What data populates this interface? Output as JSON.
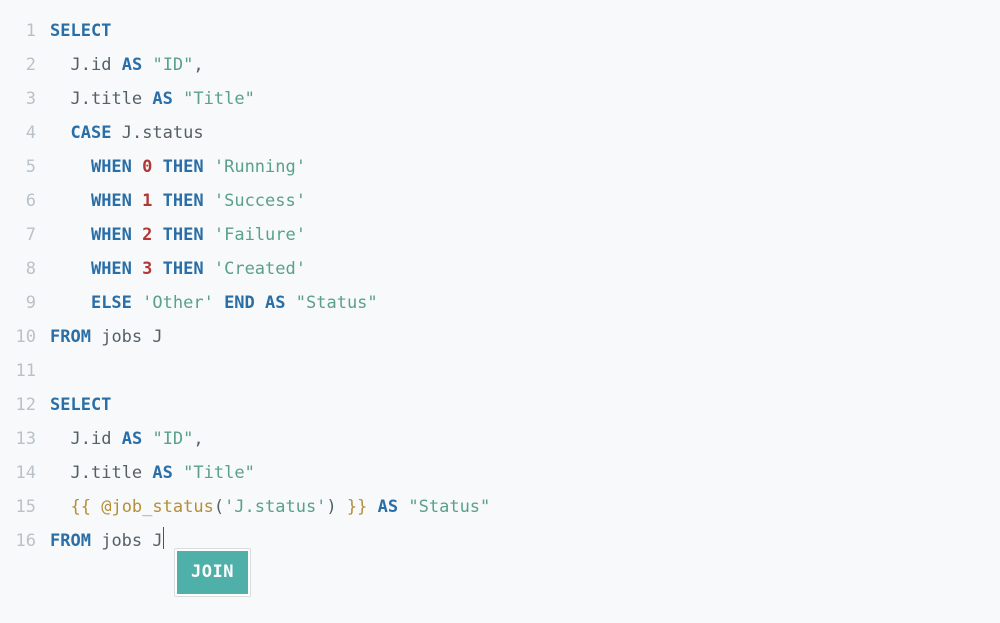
{
  "lines": [
    {
      "n": "1",
      "tokens": [
        {
          "cls": "tok-kw",
          "t": "SELECT"
        }
      ]
    },
    {
      "n": "2",
      "tokens": [
        {
          "cls": "",
          "t": "  "
        },
        {
          "cls": "tok-ident",
          "t": "J"
        },
        {
          "cls": "tok-punct",
          "t": "."
        },
        {
          "cls": "tok-ident",
          "t": "id"
        },
        {
          "cls": "",
          "t": " "
        },
        {
          "cls": "tok-kw",
          "t": "AS"
        },
        {
          "cls": "",
          "t": " "
        },
        {
          "cls": "tok-str",
          "t": "\"ID\""
        },
        {
          "cls": "tok-punct",
          "t": ","
        }
      ]
    },
    {
      "n": "3",
      "tokens": [
        {
          "cls": "",
          "t": "  "
        },
        {
          "cls": "tok-ident",
          "t": "J"
        },
        {
          "cls": "tok-punct",
          "t": "."
        },
        {
          "cls": "tok-ident",
          "t": "title"
        },
        {
          "cls": "",
          "t": " "
        },
        {
          "cls": "tok-kw",
          "t": "AS"
        },
        {
          "cls": "",
          "t": " "
        },
        {
          "cls": "tok-str",
          "t": "\"Title\""
        }
      ]
    },
    {
      "n": "4",
      "tokens": [
        {
          "cls": "",
          "t": "  "
        },
        {
          "cls": "tok-kw",
          "t": "CASE"
        },
        {
          "cls": "",
          "t": " "
        },
        {
          "cls": "tok-ident",
          "t": "J"
        },
        {
          "cls": "tok-punct",
          "t": "."
        },
        {
          "cls": "tok-ident",
          "t": "status"
        }
      ]
    },
    {
      "n": "5",
      "tokens": [
        {
          "cls": "",
          "t": "    "
        },
        {
          "cls": "tok-kw",
          "t": "WHEN"
        },
        {
          "cls": "",
          "t": " "
        },
        {
          "cls": "tok-num",
          "t": "0"
        },
        {
          "cls": "",
          "t": " "
        },
        {
          "cls": "tok-kw",
          "t": "THEN"
        },
        {
          "cls": "",
          "t": " "
        },
        {
          "cls": "tok-str",
          "t": "'Running'"
        }
      ]
    },
    {
      "n": "6",
      "tokens": [
        {
          "cls": "",
          "t": "    "
        },
        {
          "cls": "tok-kw",
          "t": "WHEN"
        },
        {
          "cls": "",
          "t": " "
        },
        {
          "cls": "tok-num",
          "t": "1"
        },
        {
          "cls": "",
          "t": " "
        },
        {
          "cls": "tok-kw",
          "t": "THEN"
        },
        {
          "cls": "",
          "t": " "
        },
        {
          "cls": "tok-str",
          "t": "'Success'"
        }
      ]
    },
    {
      "n": "7",
      "tokens": [
        {
          "cls": "",
          "t": "    "
        },
        {
          "cls": "tok-kw",
          "t": "WHEN"
        },
        {
          "cls": "",
          "t": " "
        },
        {
          "cls": "tok-num",
          "t": "2"
        },
        {
          "cls": "",
          "t": " "
        },
        {
          "cls": "tok-kw",
          "t": "THEN"
        },
        {
          "cls": "",
          "t": " "
        },
        {
          "cls": "tok-str",
          "t": "'Failure'"
        }
      ]
    },
    {
      "n": "8",
      "tokens": [
        {
          "cls": "",
          "t": "    "
        },
        {
          "cls": "tok-kw",
          "t": "WHEN"
        },
        {
          "cls": "",
          "t": " "
        },
        {
          "cls": "tok-num",
          "t": "3"
        },
        {
          "cls": "",
          "t": " "
        },
        {
          "cls": "tok-kw",
          "t": "THEN"
        },
        {
          "cls": "",
          "t": " "
        },
        {
          "cls": "tok-str",
          "t": "'Created'"
        }
      ]
    },
    {
      "n": "9",
      "tokens": [
        {
          "cls": "",
          "t": "    "
        },
        {
          "cls": "tok-kw",
          "t": "ELSE"
        },
        {
          "cls": "",
          "t": " "
        },
        {
          "cls": "tok-str",
          "t": "'Other'"
        },
        {
          "cls": "",
          "t": " "
        },
        {
          "cls": "tok-kw",
          "t": "END"
        },
        {
          "cls": "",
          "t": " "
        },
        {
          "cls": "tok-kw",
          "t": "AS"
        },
        {
          "cls": "",
          "t": " "
        },
        {
          "cls": "tok-str",
          "t": "\"Status\""
        }
      ]
    },
    {
      "n": "10",
      "tokens": [
        {
          "cls": "tok-kw",
          "t": "FROM"
        },
        {
          "cls": "",
          "t": " "
        },
        {
          "cls": "tok-ident",
          "t": "jobs"
        },
        {
          "cls": "",
          "t": " "
        },
        {
          "cls": "tok-ident",
          "t": "J"
        }
      ]
    },
    {
      "n": "11",
      "tokens": []
    },
    {
      "n": "12",
      "tokens": [
        {
          "cls": "tok-kw",
          "t": "SELECT"
        }
      ]
    },
    {
      "n": "13",
      "tokens": [
        {
          "cls": "",
          "t": "  "
        },
        {
          "cls": "tok-ident",
          "t": "J"
        },
        {
          "cls": "tok-punct",
          "t": "."
        },
        {
          "cls": "tok-ident",
          "t": "id"
        },
        {
          "cls": "",
          "t": " "
        },
        {
          "cls": "tok-kw",
          "t": "AS"
        },
        {
          "cls": "",
          "t": " "
        },
        {
          "cls": "tok-str",
          "t": "\"ID\""
        },
        {
          "cls": "tok-punct",
          "t": ","
        }
      ]
    },
    {
      "n": "14",
      "tokens": [
        {
          "cls": "",
          "t": "  "
        },
        {
          "cls": "tok-ident",
          "t": "J"
        },
        {
          "cls": "tok-punct",
          "t": "."
        },
        {
          "cls": "tok-ident",
          "t": "title"
        },
        {
          "cls": "",
          "t": " "
        },
        {
          "cls": "tok-kw",
          "t": "AS"
        },
        {
          "cls": "",
          "t": " "
        },
        {
          "cls": "tok-str",
          "t": "\"Title\""
        }
      ]
    },
    {
      "n": "15",
      "tokens": [
        {
          "cls": "",
          "t": "  "
        },
        {
          "cls": "tok-tmpl",
          "t": "{{"
        },
        {
          "cls": "",
          "t": " "
        },
        {
          "cls": "tok-fn",
          "t": "@job_status"
        },
        {
          "cls": "tok-par",
          "t": "("
        },
        {
          "cls": "tok-str",
          "t": "'J.status'"
        },
        {
          "cls": "tok-par",
          "t": ")"
        },
        {
          "cls": "",
          "t": " "
        },
        {
          "cls": "tok-tmpl",
          "t": "}}"
        },
        {
          "cls": "",
          "t": " "
        },
        {
          "cls": "tok-kw",
          "t": "AS"
        },
        {
          "cls": "",
          "t": " "
        },
        {
          "cls": "tok-str",
          "t": "\"Status\""
        }
      ]
    },
    {
      "n": "16",
      "tokens": [
        {
          "cls": "tok-kw",
          "t": "FROM"
        },
        {
          "cls": "",
          "t": " "
        },
        {
          "cls": "tok-ident",
          "t": "jobs"
        },
        {
          "cls": "",
          "t": " "
        },
        {
          "cls": "tok-ident",
          "t": "J"
        }
      ],
      "caret_after": true,
      "suggest": {
        "label": "JOIN"
      }
    }
  ]
}
